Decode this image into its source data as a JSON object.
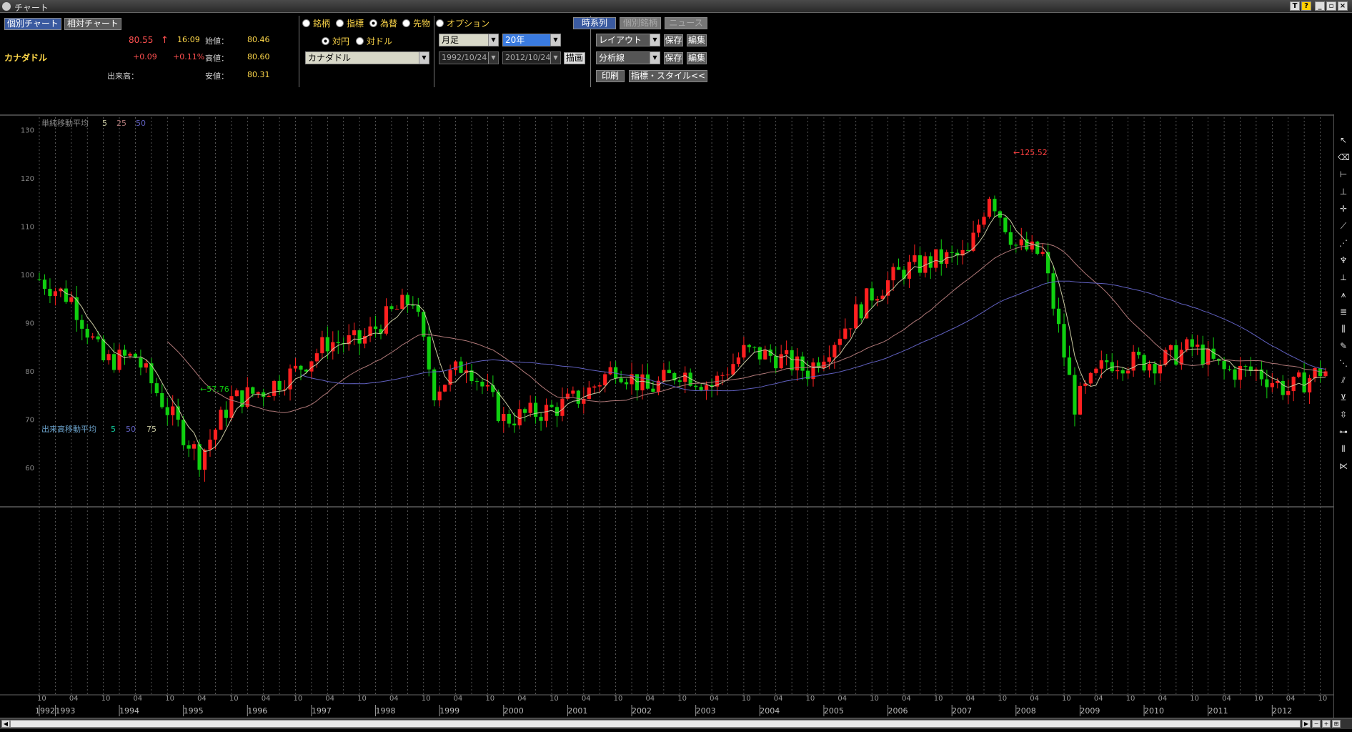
{
  "window": {
    "title": "チャート",
    "buttons": [
      "T",
      "?",
      "_",
      "▫",
      "×"
    ]
  },
  "tabs": {
    "individual": "個別チャート",
    "relative": "相対チャート"
  },
  "quote": {
    "name": "カナダドル",
    "price": "80.55",
    "arrow": "↑",
    "time": "16:09",
    "change": "+0.09",
    "change_pct": "+0.11%",
    "volume_label": "出来高：",
    "open_label": "始値：",
    "open": "80.46",
    "high_label": "高値：",
    "high": "80.60",
    "low_label": "安値：",
    "low": "80.31"
  },
  "asset_type": {
    "options": [
      "銘柄",
      "指標",
      "為替",
      "先物",
      "オプション"
    ],
    "selected": "為替"
  },
  "quote_base": {
    "options": [
      "対円",
      "対ドル"
    ],
    "selected": "対円"
  },
  "currency_select": "カナダドル",
  "period": {
    "interval": "月足",
    "span": "20年",
    "from": "1992/10/24",
    "to": "2012/10/24",
    "draw_label": "描画"
  },
  "right_controls": {
    "timeseries": "時系列",
    "individual_brand": "個別銘柄",
    "news": "ニュース",
    "layout": "レイアウト",
    "analysis": "分析線",
    "save": "保存",
    "edit": "編集",
    "print": "印刷",
    "indicator_style": "指標・スタイル<<"
  },
  "price_panel": {
    "indicator_label": "単純移動平均",
    "ma_periods": [
      "5",
      "25",
      "50"
    ],
    "max_marker": "←125.52",
    "min_marker": "←57.76"
  },
  "volume_panel": {
    "indicator_label": "出来高移動平均",
    "ma_periods": [
      "5",
      "50",
      "75"
    ]
  },
  "colors": {
    "up": "#ff2020",
    "down": "#10d010",
    "ma5": "#c8c8a0",
    "ma25": "#b07878",
    "ma50": "#6060c0"
  },
  "chart_data": {
    "type": "candlestick",
    "x_years": [
      "1992",
      "1993",
      "1994",
      "1995",
      "1996",
      "1997",
      "1998",
      "1999",
      "2000",
      "2001",
      "2002",
      "2003",
      "2004",
      "2005",
      "2006",
      "2007",
      "2008",
      "2009",
      "2010",
      "2011",
      "2012"
    ],
    "month_ticks": [
      "10",
      "04",
      "10"
    ],
    "yticks": [
      60,
      70,
      80,
      90,
      100,
      110,
      120,
      130
    ],
    "ylim": [
      52,
      131
    ],
    "anchor_points": [
      [
        "1992/10",
        99
      ],
      [
        "1993/04",
        95
      ],
      [
        "1993/10",
        82
      ],
      [
        "1994/04",
        83
      ],
      [
        "1994/10",
        72
      ],
      [
        "1995/04",
        62
      ],
      [
        "1995/10",
        74
      ],
      [
        "1996/04",
        76
      ],
      [
        "1996/10",
        80
      ],
      [
        "1997/04",
        86
      ],
      [
        "1997/10",
        86
      ],
      [
        "1998/04",
        92
      ],
      [
        "1998/08",
        95
      ],
      [
        "1998/12",
        76
      ],
      [
        "1999/06",
        82
      ],
      [
        "2000/01",
        70
      ],
      [
        "2000/10",
        72
      ],
      [
        "2001/04",
        75
      ],
      [
        "2001/10",
        81
      ],
      [
        "2002/04",
        76
      ],
      [
        "2002/10",
        80
      ],
      [
        "2003/04",
        77
      ],
      [
        "2003/10",
        84
      ],
      [
        "2004/04",
        83
      ],
      [
        "2004/10",
        80
      ],
      [
        "2005/04",
        88
      ],
      [
        "2005/10",
        96
      ],
      [
        "2006/04",
        101
      ],
      [
        "2006/10",
        103
      ],
      [
        "2007/04",
        104
      ],
      [
        "2007/08",
        117
      ],
      [
        "2008/01",
        106
      ],
      [
        "2008/06",
        104
      ],
      [
        "2008/12",
        73
      ],
      [
        "2009/06",
        82
      ],
      [
        "2010/04",
        82
      ],
      [
        "2010/10",
        85
      ],
      [
        "2011/04",
        80
      ],
      [
        "2011/10",
        80
      ],
      [
        "2012/04",
        76
      ],
      [
        "2012/10",
        80
      ]
    ]
  }
}
